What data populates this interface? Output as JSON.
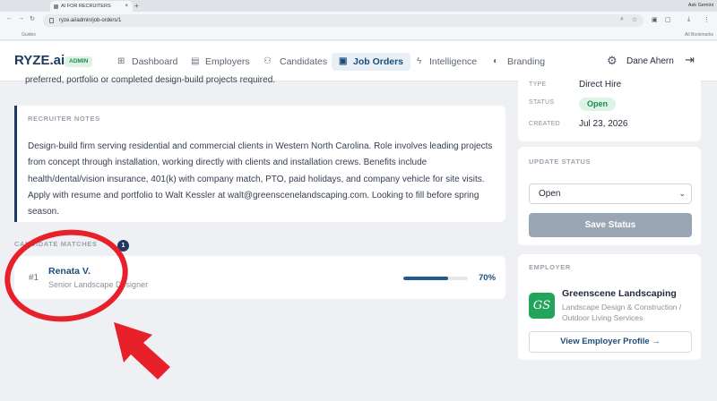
{
  "browser": {
    "tab_title": "AI FOR RECRUITERS",
    "tab_close": "×",
    "new_tab": "+",
    "gemini_label": "Ask Gemini",
    "url": "ryze.ai/admin/job-orders/1",
    "bookmarks_left": "Guides",
    "bookmarks_right": "All Bookmarks"
  },
  "app": {
    "logo": "RYZE.ai",
    "admin_badge": "ADMIN",
    "nav": [
      {
        "label": "Dashboard",
        "icon": "dashboard-icon"
      },
      {
        "label": "Employers",
        "icon": "building-icon"
      },
      {
        "label": "Candidates",
        "icon": "people-icon"
      },
      {
        "label": "Job Orders",
        "icon": "briefcase-icon",
        "active": true
      },
      {
        "label": "Intelligence",
        "icon": "bolt-icon"
      },
      {
        "label": "Branding",
        "icon": "palette-icon"
      }
    ],
    "user_name": "Dane Ahern"
  },
  "job": {
    "prev_text": "preferred, portfolio or completed design-build projects required.",
    "notes_title": "RECRUITER NOTES",
    "notes_body": "Design-build firm serving residential and commercial clients in Western North Carolina. Role involves leading projects from concept through installation, working directly with clients and installation crews. Benefits include health/dental/vision insurance, 401(k) with company match, PTO, paid holidays, and company vehicle for site visits. Apply with resume and portfolio to Walt Kessler at walt@greenscenelandscaping.com. Looking to fill before spring season.",
    "matches_title": "CANDIDATE MATCHES",
    "matches_count": "1",
    "matches": [
      {
        "rank": "#1",
        "name": "Renata V.",
        "role": "Senior Landscape Designer",
        "score_label": "70%",
        "score": 0.7
      }
    ]
  },
  "info": {
    "type_label": "TYPE",
    "type_value": "Direct Hire",
    "status_label": "STATUS",
    "status_value": "Open",
    "created_label": "CREATED",
    "created_value": "Jul 23, 2026"
  },
  "update_status": {
    "title": "UPDATE STATUS",
    "selected": "Open",
    "save_label": "Save Status"
  },
  "employer": {
    "title": "EMPLOYER",
    "logo_text": "GS",
    "name": "Greenscene Landscaping",
    "description": "Landscape Design & Construction / Outdoor Living Services",
    "view_button": "View Employer Profile →"
  },
  "colors": {
    "brand": "#1e3a5f",
    "accent_green": "#22a55b",
    "annotation_red": "#e8202a"
  }
}
